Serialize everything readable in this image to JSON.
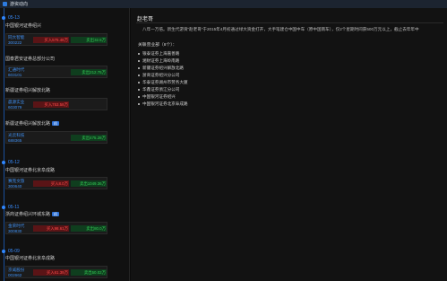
{
  "window": {
    "title": "游资动向"
  },
  "left": {
    "groups": [
      {
        "date": "05-13",
        "entries": [
          {
            "dept": "中国银河证券绍兴",
            "tag": "",
            "stock": "同大智能",
            "code": "300222",
            "buy": "买入575.48万",
            "sell": "卖出32.5万"
          },
          {
            "dept": "国泰君安证券总部分公司",
            "tag": "",
            "stock": "汇通时代",
            "code": "603101",
            "buy": "",
            "sell": "卖出212.75万"
          },
          {
            "dept": "新疆证券绍兴解放北路",
            "tag": "",
            "stock": "晨源实业",
            "code": "603079",
            "buy": "买入753.58万",
            "sell": ""
          },
          {
            "dept": "新疆证券绍兴解放北路",
            "tag": "机",
            "stock": "光云科技",
            "code": "688365",
            "buy": "",
            "sell": "卖出475.28万"
          }
        ]
      },
      {
        "date": "05-12",
        "entries": [
          {
            "dept": "中国银河证券北京阜成路",
            "tag": "",
            "stock": "赛克文旅",
            "code": "300640",
            "buy": "买入8.0万",
            "sell": "卖出1049.36万"
          }
        ]
      },
      {
        "date": "05-11",
        "entries": [
          {
            "dept": "浙商证券绍兴环城东路",
            "tag": "机",
            "stock": "金荣时代",
            "code": "300830",
            "buy": "买入98.61万",
            "sell": "卖出80.0万"
          }
        ]
      },
      {
        "date": "05-09",
        "entries": [
          {
            "dept": "中国银河证券北京阜成路",
            "tag": "",
            "stock": "京威股份",
            "code": "002662",
            "buy": "买入61.39万",
            "sell": "卖出50.02万"
          }
        ]
      }
    ]
  },
  "detail": {
    "name": "赵老哥",
    "intro": "八年一万倍。新生代游资“赵老哥”于2015年4月初通过绿大资金打开，大手笔建仓中国中车（原中国南车），仅2个星期时间获500万元以上，截止去年年中",
    "seats_title": "关联营业部（8个）：",
    "seats": [
      "银泰证券上海嘉善路",
      "湘财证券上海岭南路",
      "新疆证券绍兴解放北路",
      "浙商证券绍兴分公司",
      "华泰证券湖州市劳务大厦",
      "华鑫证券浙江分公司",
      "中国银河证券绍兴",
      "中国银河证券北京阜成路"
    ]
  }
}
